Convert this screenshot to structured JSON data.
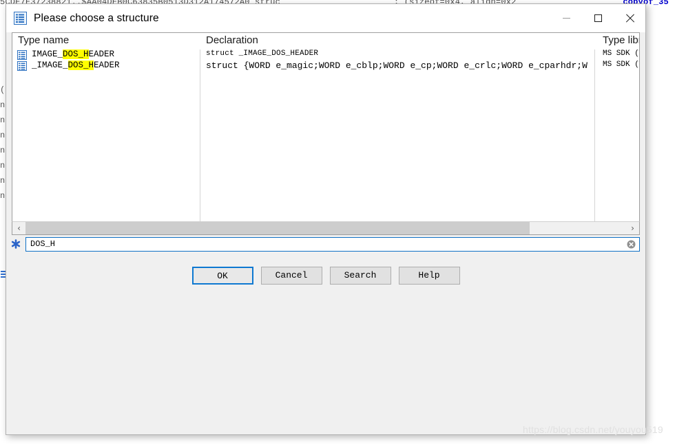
{
  "background": {
    "top_line_left": "5CDE7E37238821..$AA04DEB0C63835B0513D312A174572A0  struc",
    "top_line_right": "; (sizeof=0x4, align=0x2",
    "top_line_blue": "copyof_35",
    "top_line_end": ")",
    "left_fragments": [
      "(",
      "n",
      "n",
      "n",
      "n",
      "n",
      "n",
      "n"
    ]
  },
  "dialog": {
    "title": "Please choose a structure",
    "title_icon": "struct-list-icon",
    "window_controls": {
      "minimize": "minimize-icon",
      "maximize": "maximize-icon",
      "close": "close-icon"
    },
    "columns": [
      {
        "key": "type_name",
        "label": "Type name"
      },
      {
        "key": "declaration",
        "label": "Declaration"
      },
      {
        "key": "type_library",
        "label": "Type library"
      }
    ],
    "rows": [
      {
        "icon": "struct-list-icon",
        "name_prefix": "IMAGE_",
        "name_highlight": "DOS_H",
        "name_suffix": "EADER",
        "declaration": "struct _IMAGE_DOS_HEADER",
        "type_library": "MS SDK (Window"
      },
      {
        "icon": "struct-list-icon",
        "name_prefix": "_IMAGE_",
        "name_highlight": "DOS_H",
        "name_suffix": "EADER",
        "declaration": "struct {WORD e_magic;WORD e_cblp;WORD e_cp;WORD e_crlc;WORD e_cparhdr;W",
        "type_library": "MS SDK (Window"
      }
    ],
    "hscrollbar": {
      "left_arrow": "‹",
      "right_arrow": "›",
      "thumb_percent": 84
    },
    "filter": {
      "icon": "filter-asterisk-icon",
      "value": "DOS_H",
      "placeholder": "",
      "clear_icon": "clear-circle-icon"
    },
    "buttons": [
      {
        "label": "OK",
        "default": true
      },
      {
        "label": "Cancel",
        "default": false
      },
      {
        "label": "Search",
        "default": false
      },
      {
        "label": "Help",
        "default": false
      }
    ]
  },
  "watermark": "https://blog.csdn.net/youyou519",
  "colors": {
    "accent": "#0d78d1",
    "highlight": "#ffff00",
    "dialog_bg": "#f0f0f0",
    "list_bg": "#ffffff"
  }
}
